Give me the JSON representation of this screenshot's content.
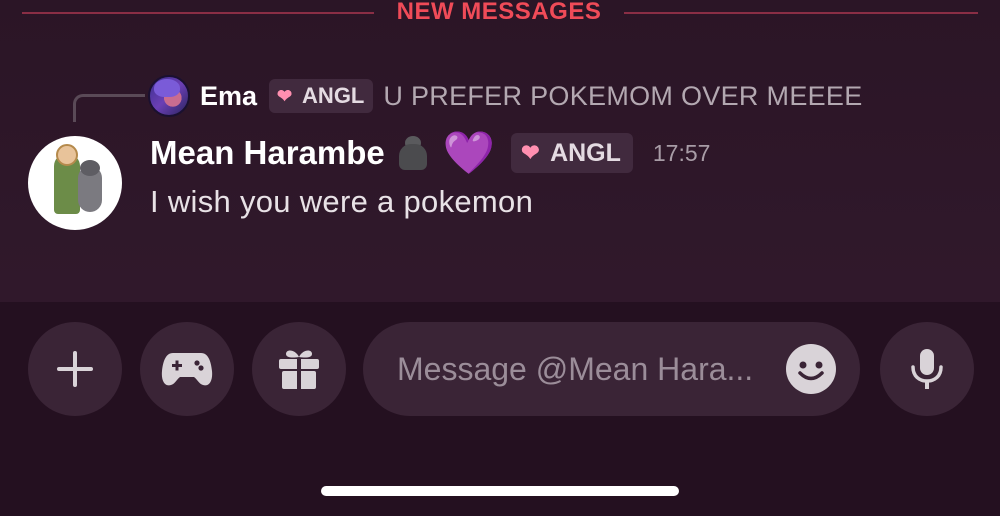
{
  "divider": {
    "label": "NEW MESSAGES",
    "color": "#f04b58"
  },
  "reply": {
    "username": "Ema",
    "tag": "ANGL",
    "text": "U PREFER POKEMOM OVER MEEEE"
  },
  "message": {
    "username": "Mean Harambe",
    "emojis": [
      "gorilla-icon",
      "purple-heart-icon"
    ],
    "purple_heart": "💜",
    "tag": "ANGL",
    "timestamp": "17:57",
    "text": "I wish you were a pokemon"
  },
  "composer": {
    "placeholder": "Message @Mean Hara...",
    "buttons": [
      "plus-icon",
      "gamepad-icon",
      "gift-icon",
      "emoji-icon",
      "microphone-icon"
    ]
  },
  "colors": {
    "background": "#2b1526",
    "accent_red": "#f04b58",
    "tag_bg": "#412a3e",
    "input_bg": "#3a2436"
  }
}
